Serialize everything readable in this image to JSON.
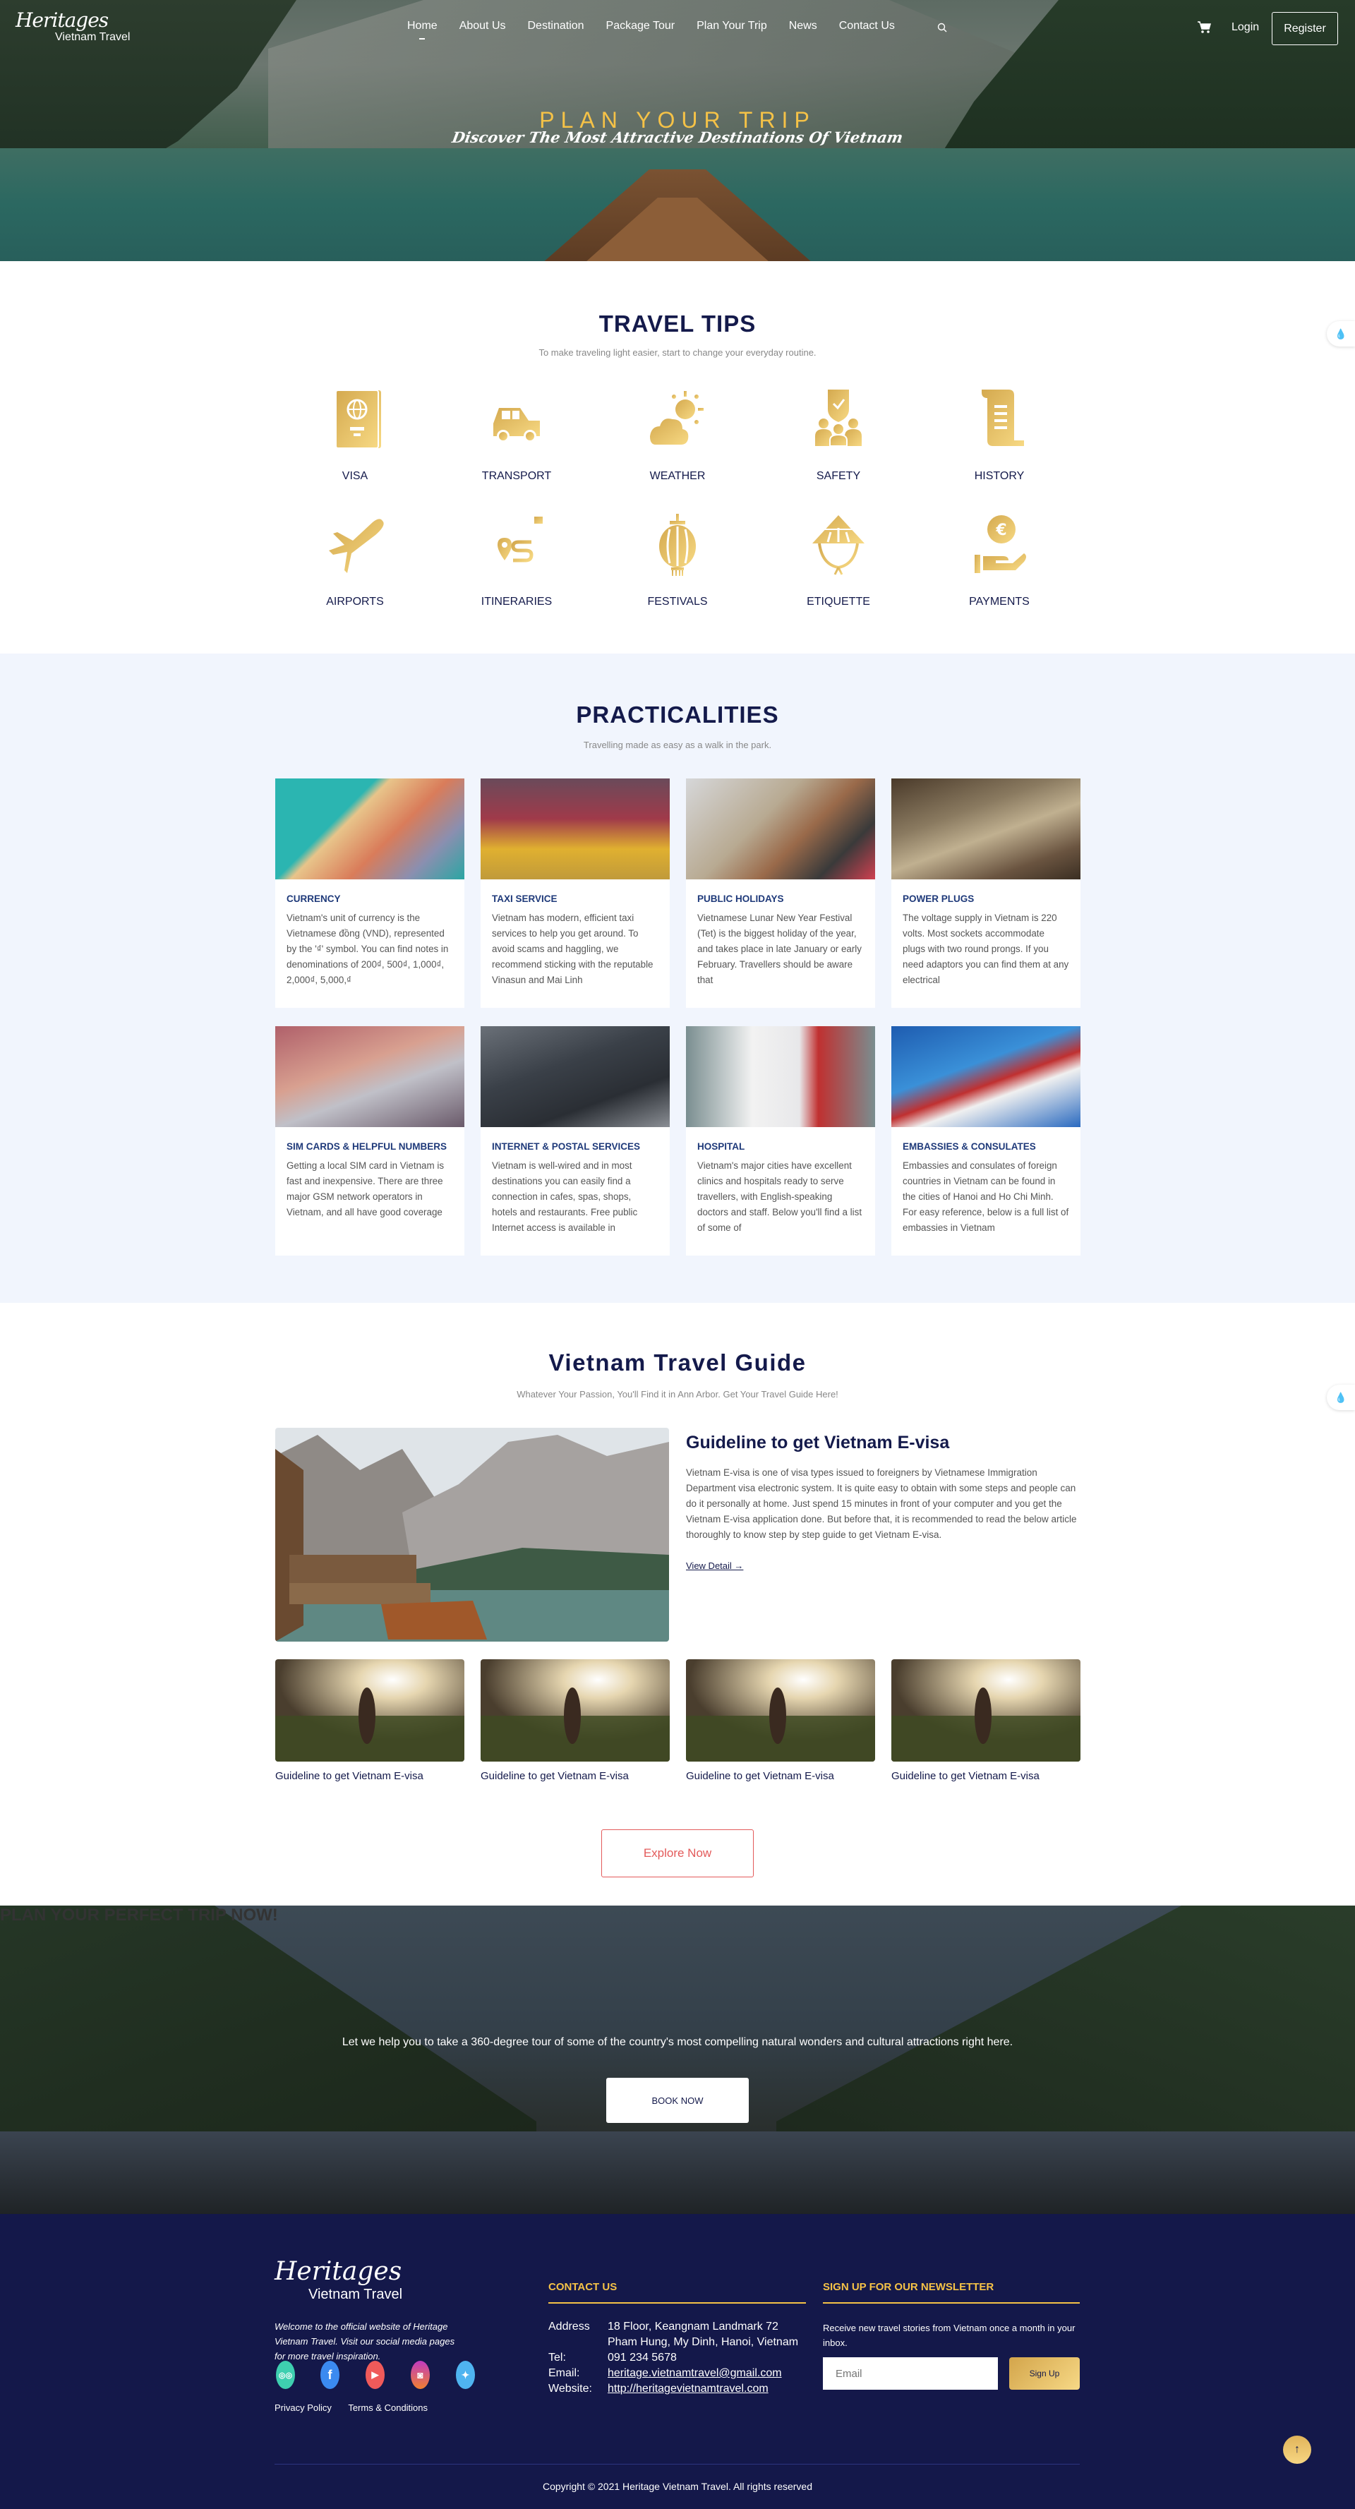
{
  "brand": {
    "script": "Heritages",
    "sub": "Vietnam Travel"
  },
  "nav": {
    "items": [
      {
        "label": "Home",
        "active": true
      },
      {
        "label": "About Us"
      },
      {
        "label": "Destination"
      },
      {
        "label": "Package Tour"
      },
      {
        "label": "Plan Your Trip"
      },
      {
        "label": "News"
      },
      {
        "label": "Contact Us"
      }
    ],
    "login": "Login",
    "register": "Register",
    "search_icon": "search-icon",
    "cart_icon": "cart-icon"
  },
  "hero": {
    "title": "PLAN YOUR TRIP",
    "subtitle": "Discover The Most Attractive Destinations Of Vietnam"
  },
  "tips": {
    "title": "TRAVEL TIPS",
    "subtitle": "To make traveling light easier, start to change your everyday routine.",
    "icon_color": "#e2b65a",
    "items": [
      {
        "label": "VISA",
        "icon": "passport-icon"
      },
      {
        "label": "TRANSPORT",
        "icon": "car-icon"
      },
      {
        "label": "WEATHER",
        "icon": "sun-cloud-icon"
      },
      {
        "label": "SAFETY",
        "icon": "shield-people-icon"
      },
      {
        "label": "HISTORY",
        "icon": "scroll-icon"
      },
      {
        "label": "AIRPORTS",
        "icon": "airplane-icon"
      },
      {
        "label": "ITINERARIES",
        "icon": "route-pin-icon"
      },
      {
        "label": "FESTIVALS",
        "icon": "lantern-icon"
      },
      {
        "label": "ETIQUETTE",
        "icon": "conical-hat-icon"
      },
      {
        "label": "PAYMENTS",
        "icon": "hand-coin-icon"
      }
    ]
  },
  "practicalities": {
    "title": "PRACTICALITIES",
    "subtitle": "Travelling made as easy as a walk in the park.",
    "cards": [
      {
        "title": "CURRENCY",
        "text": "Vietnam's unit of currency is the Vietnamese đồng (VND), represented by the '₫' symbol. You can find notes in denominations of 200₫, 500₫, 1,000₫, 2,000₫, 5,000,₫"
      },
      {
        "title": "TAXI SERVICE",
        "text": "Vietnam has modern, efficient taxi services to help you get around. To avoid scams and haggling, we recommend sticking with the reputable Vinasun and Mai Linh"
      },
      {
        "title": "PUBLIC HOLIDAYS",
        "text": "Vietnamese Lunar New Year Festival (Tet) is the biggest holiday of the year, and takes place in late January or early February. Travellers should be aware that"
      },
      {
        "title": "POWER PLUGS",
        "text": "The voltage supply in Vietnam is 220 volts. Most sockets accommodate plugs with two round prongs. If you need adaptors you can find them at any electrical"
      },
      {
        "title": "SIM CARDS & HELPFUL NUMBERS",
        "text": "Getting a local SIM card in Vietnam is fast and inexpensive. There are three major GSM network operators in Vietnam, and all have good coverage"
      },
      {
        "title": "INTERNET & POSTAL SERVICES",
        "text": "Vietnam is well-wired and in most destinations you can easily find a connection in cafes, spas, shops, hotels and restaurants. Free public Internet access is available in"
      },
      {
        "title": "HOSPITAL",
        "text": "Vietnam's major cities have excellent clinics and hospitals ready to serve travellers, with English-speaking doctors and staff. Below you'll find a list of some of"
      },
      {
        "title": "EMBASSIES & CONSULATES",
        "text": "Embassies and consulates of foreign countries in Vietnam can be found in the cities of Hanoi and Ho Chi Minh. For easy reference, below is a full list of embassies in Vietnam"
      }
    ]
  },
  "guide": {
    "title": "Vietnam Travel Guide",
    "subtitle": "Whatever Your Passion, You'll Find it in Ann Arbor. Get Your Travel Guide Here!",
    "feature": {
      "title": "Guideline to get Vietnam E-visa",
      "body": "Vietnam E-visa is one of visa types issued to foreigners by Vietnamese Immigration Department visa electronic system. It is quite easy to obtain with some steps and people can do it personally at home. Just spend 15 minutes in front of your computer and you get the Vietnam E-visa application done. But before that, it is recommended to read the below article thoroughly to know step by step guide to get Vietnam E-visa.",
      "link": "View Detail →"
    },
    "items": [
      {
        "caption": "Guideline to get Vietnam E-visa"
      },
      {
        "caption": "Guideline to get Vietnam E-visa"
      },
      {
        "caption": "Guideline to get Vietnam E-visa"
      },
      {
        "caption": "Guideline to get Vietnam E-visa"
      }
    ],
    "explore": "Explore Now"
  },
  "cta": {
    "title": "PLAN YOUR PERFECT TRIP NOW!",
    "text": "Let we help you to take a 360-degree tour of some of the country's most compelling natural wonders and cultural attractions right here.",
    "button": "BOOK NOW"
  },
  "footer": {
    "logo_script": "Heritages",
    "logo_sub": "Vietnam Travel",
    "welcome": "Welcome to the official website of Heritage Vietnam Travel. Visit our social media pages for more travel inspiration.",
    "social": [
      {
        "name": "tripadvisor",
        "glyph": "◎◎",
        "color": "#3ecfb0"
      },
      {
        "name": "facebook",
        "glyph": "f",
        "color": "#3b8af0"
      },
      {
        "name": "youtube",
        "glyph": "▶",
        "color": "#f05a5a"
      },
      {
        "name": "instagram",
        "glyph": "◙",
        "color": "#f0568a"
      },
      {
        "name": "twitter",
        "glyph": "✦",
        "color": "#4fb4f0"
      }
    ],
    "links": [
      "Privacy Policy",
      "Terms & Conditions"
    ],
    "contact": {
      "title": "CONTACT US",
      "address_label": "Address",
      "address_1": "18 Floor, Keangnam Landmark 72",
      "address_2": "Pham Hung, My Dinh, Hanoi, Vietnam",
      "tel_label": "Tel:",
      "tel": "091 234 5678",
      "email_label": "Email:",
      "email": "heritage.vietnamtravel@gmail.com",
      "website_label": "Website:",
      "website": "http://heritagevietnamtravel.com"
    },
    "newsletter": {
      "title": "SIGN UP FOR OUR NEWSLETTER",
      "text": "Receive new travel stories from Vietnam once a month in your inbox.",
      "placeholder": "Email",
      "button": "Sign Up"
    },
    "copyright": "Copyright © 2021 Heritage Vietnam Travel. All rights reserved",
    "to_top": "↑"
  },
  "colors": {
    "navy": "#141a4b",
    "gold": "#f5c247",
    "accent_red": "#e35a5a",
    "prac_bg": "#f1f5fd"
  }
}
